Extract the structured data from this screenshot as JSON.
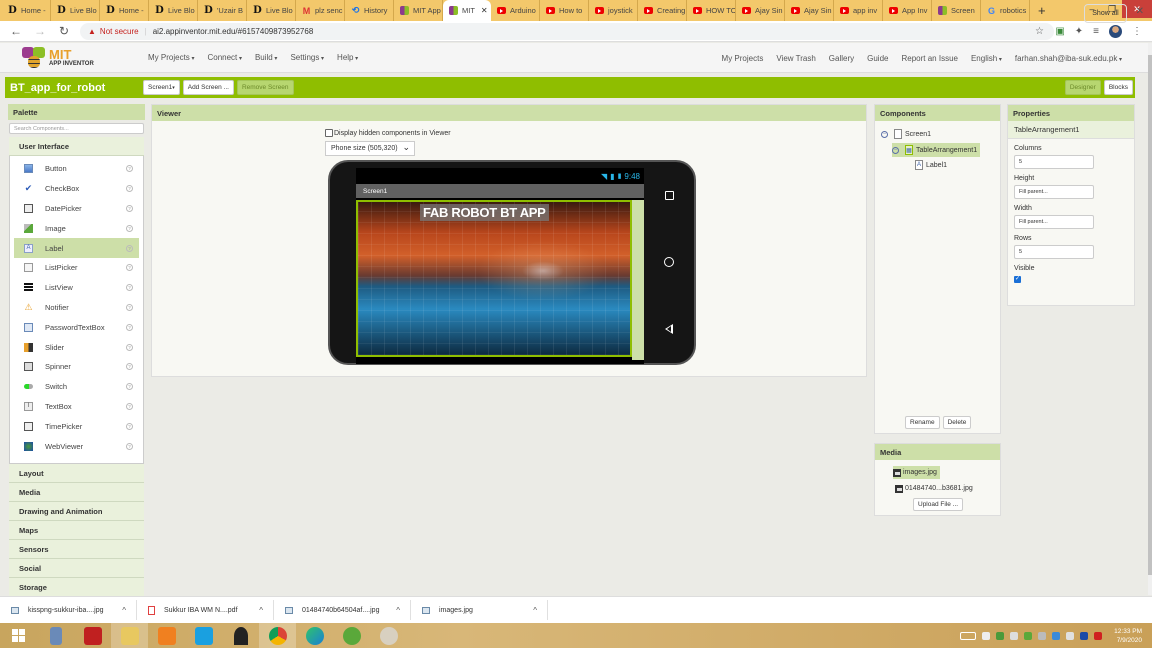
{
  "browser": {
    "tabs": [
      {
        "icon": "d-icon",
        "label": "Home -"
      },
      {
        "icon": "d-icon",
        "label": "Live Blo"
      },
      {
        "icon": "d-icon",
        "label": "Home -"
      },
      {
        "icon": "d-icon",
        "label": "Live Blo"
      },
      {
        "icon": "d-icon",
        "label": "'Uzair B"
      },
      {
        "icon": "d-icon",
        "label": "Live Blo"
      },
      {
        "icon": "gmail-icon",
        "label": "plz senc"
      },
      {
        "icon": "history-icon",
        "label": "History"
      },
      {
        "icon": "mit-icon",
        "label": "MIT App"
      },
      {
        "icon": "mit-icon",
        "label": "MIT",
        "active": true
      },
      {
        "icon": "youtube-icon",
        "label": "Arduino"
      },
      {
        "icon": "youtube-icon",
        "label": "How to"
      },
      {
        "icon": "youtube-icon",
        "label": "joystick"
      },
      {
        "icon": "youtube-icon",
        "label": "Creating"
      },
      {
        "icon": "youtube-icon",
        "label": "HOW TO"
      },
      {
        "icon": "youtube-icon",
        "label": "Ajay Sin"
      },
      {
        "icon": "youtube-icon",
        "label": "Ajay Sin"
      },
      {
        "icon": "youtube-icon",
        "label": "app inv"
      },
      {
        "icon": "youtube-icon",
        "label": "App Inv"
      },
      {
        "icon": "mit-icon",
        "label": "Screen"
      },
      {
        "icon": "google-icon",
        "label": "robotics"
      }
    ],
    "security_label": "Not secure",
    "url": "ai2.appinventor.mit.edu/#6157409873952768"
  },
  "app": {
    "logo_line1": "MIT",
    "logo_line2": "APP INVENTOR",
    "menu": [
      "My Projects",
      "Connect",
      "Build",
      "Settings",
      "Help"
    ],
    "right_menu": [
      "My Projects",
      "View Trash",
      "Gallery",
      "Guide",
      "Report an Issue",
      "English",
      "farhan.shah@iba-suk.edu.pk"
    ],
    "project_name": "BT_app_for_robot",
    "screen_select": "Screen1",
    "add_screen": "Add Screen ...",
    "remove_screen": "Remove Screen",
    "designer": "Designer",
    "blocks": "Blocks"
  },
  "palette": {
    "title": "Palette",
    "search_placeholder": "Search Components...",
    "active_category": "User Interface",
    "items": [
      {
        "label": "Button",
        "icon": "button-icon"
      },
      {
        "label": "CheckBox",
        "icon": "checkbox-icon"
      },
      {
        "label": "DatePicker",
        "icon": "datepicker-icon"
      },
      {
        "label": "Image",
        "icon": "image-icon"
      },
      {
        "label": "Label",
        "icon": "label-icon",
        "selected": true
      },
      {
        "label": "ListPicker",
        "icon": "listpicker-icon"
      },
      {
        "label": "ListView",
        "icon": "listview-icon"
      },
      {
        "label": "Notifier",
        "icon": "notifier-icon"
      },
      {
        "label": "PasswordTextBox",
        "icon": "password-icon"
      },
      {
        "label": "Slider",
        "icon": "slider-icon"
      },
      {
        "label": "Spinner",
        "icon": "spinner-icon"
      },
      {
        "label": "Switch",
        "icon": "switch-icon"
      },
      {
        "label": "TextBox",
        "icon": "textbox-icon"
      },
      {
        "label": "TimePicker",
        "icon": "timepicker-icon"
      },
      {
        "label": "WebViewer",
        "icon": "webviewer-icon"
      }
    ],
    "categories": [
      "Layout",
      "Media",
      "Drawing and Animation",
      "Maps",
      "Sensors",
      "Social",
      "Storage"
    ]
  },
  "viewer": {
    "title": "Viewer",
    "hidden_components_label": "Display hidden components in Viewer",
    "size_select": "Phone size (505,320)",
    "phone_time": "9:48",
    "screen_title": "Screen1",
    "label_text": "FAB ROBOT BT APP"
  },
  "components": {
    "title": "Components",
    "tree": [
      {
        "label": "Screen1",
        "level": 0
      },
      {
        "label": "TableArrangement1",
        "level": 1,
        "selected": true
      },
      {
        "label": "Label1",
        "level": 2
      }
    ],
    "rename": "Rename",
    "delete": "Delete"
  },
  "properties": {
    "title": "Properties",
    "component": "TableArrangement1",
    "fields": [
      {
        "label": "Columns",
        "value": "5"
      },
      {
        "label": "Height",
        "value": "Fill parent..."
      },
      {
        "label": "Width",
        "value": "Fill parent..."
      },
      {
        "label": "Rows",
        "value": "5"
      }
    ],
    "visible_label": "Visible",
    "visible": true
  },
  "media": {
    "title": "Media",
    "files": [
      {
        "name": "images.jpg",
        "selected": true
      },
      {
        "name": "01484740...b3681.jpg"
      }
    ],
    "upload": "Upload File ..."
  },
  "downloads": {
    "items": [
      {
        "name": "kisspng-sukkur-iba....jpg",
        "type": "image"
      },
      {
        "name": "Sukkur IBA WM N....pdf",
        "type": "pdf"
      },
      {
        "name": "01484740b64504af....jpg",
        "type": "image"
      },
      {
        "name": "images.jpg",
        "type": "image"
      }
    ],
    "show_all": "Show all"
  },
  "taskbar": {
    "time": "12:33 PM",
    "date": "7/9/2020"
  }
}
